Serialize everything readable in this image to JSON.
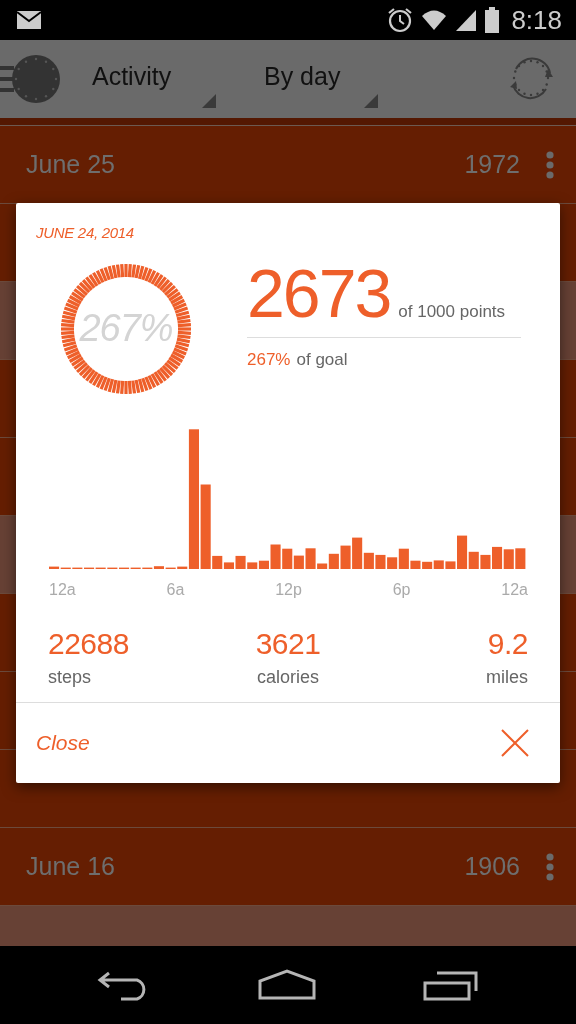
{
  "status_bar": {
    "time": "8:18"
  },
  "toolbar": {
    "spinners": [
      {
        "label": "Activity"
      },
      {
        "label": "By day"
      }
    ]
  },
  "days": [
    {
      "label": "June 25",
      "points": "1972",
      "color": "#651e02"
    },
    {
      "color": "#651e02"
    },
    {
      "color": "#674135"
    },
    {
      "color": "#651e02"
    },
    {
      "color": "#651e02"
    },
    {
      "color": "#674135"
    },
    {
      "color": "#651e02"
    },
    {
      "color": "#651e02"
    },
    {
      "color": "#651e02"
    },
    {
      "label": "June 16",
      "points": "1906",
      "color": "#651e02"
    },
    {
      "color": "#674135"
    }
  ],
  "dialog": {
    "date": "JUNE 24, 2014",
    "ring": {
      "label": "267%"
    },
    "points": "2673",
    "points_caption": "of 1000 points",
    "goal_percent": "267%",
    "goal_caption": "of goal",
    "chart_x_labels": [
      "12a",
      "6a",
      "12p",
      "6p",
      "12a"
    ],
    "stats": [
      {
        "value": "22688",
        "label": "steps"
      },
      {
        "value": "3621",
        "label": "calories"
      },
      {
        "value": "9.2",
        "label": "miles"
      }
    ],
    "close": "Close"
  }
}
